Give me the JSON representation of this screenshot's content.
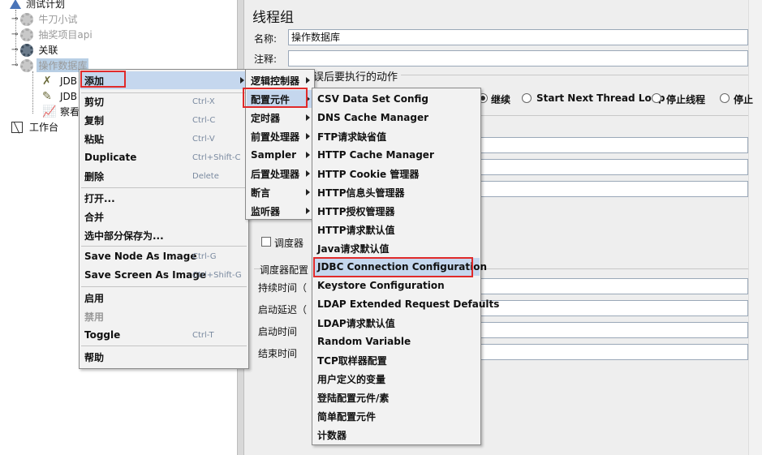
{
  "tree": {
    "test_plan": "测试计划",
    "nodes": [
      "牛刀小试",
      "抽奖项目api",
      "关联",
      "操作数据库"
    ],
    "children": [
      "JDB",
      "JDB",
      "察看"
    ],
    "workbench": "工作台"
  },
  "panel": {
    "title": "线程组",
    "name_label": "名称:",
    "name_value": "操作数据库",
    "comment_label": "注释:",
    "error_action_partial": "误后要执行的动作",
    "options": [
      "继续",
      "Start Next Thread Loop",
      "停止线程",
      "停止"
    ],
    "scheduler_checkbox": "调度器",
    "scheduler_config": "调度器配置",
    "duration_label": "持续时间（",
    "startup_delay_label": "启动延迟（",
    "start_time_label": "启动时间",
    "end_time_label": "结束时间"
  },
  "context_menu": {
    "items": [
      {
        "label": "添加",
        "accel": ""
      },
      {
        "label": "剪切",
        "accel": "Ctrl-X"
      },
      {
        "label": "复制",
        "accel": "Ctrl-C"
      },
      {
        "label": "粘贴",
        "accel": "Ctrl-V"
      },
      {
        "label": "Duplicate",
        "accel": "Ctrl+Shift-C"
      },
      {
        "label": "删除",
        "accel": "Delete"
      },
      {
        "label": "打开...",
        "accel": ""
      },
      {
        "label": "合并",
        "accel": ""
      },
      {
        "label": "选中部分保存为...",
        "accel": ""
      },
      {
        "label": "Save Node As Image",
        "accel": "Ctrl-G"
      },
      {
        "label": "Save Screen As Image",
        "accel": "Ctrl+Shift-G"
      },
      {
        "label": "启用",
        "accel": ""
      },
      {
        "label": "禁用",
        "accel": ""
      },
      {
        "label": "Toggle",
        "accel": "Ctrl-T"
      },
      {
        "label": "帮助",
        "accel": ""
      }
    ]
  },
  "add_submenu": {
    "items": [
      "逻辑控制器",
      "配置元件",
      "定时器",
      "前置处理器",
      "Sampler",
      "后置处理器",
      "断言",
      "监听器"
    ]
  },
  "config_submenu": {
    "items": [
      "CSV Data Set Config",
      "DNS Cache Manager",
      "FTP请求缺省值",
      "HTTP Cache Manager",
      "HTTP Cookie 管理器",
      "HTTP信息头管理器",
      "HTTP授权管理器",
      "HTTP请求默认值",
      "Java请求默认值",
      "JDBC Connection Configuration",
      "Keystore Configuration",
      "LDAP Extended Request Defaults",
      "LDAP请求默认值",
      "Random Variable",
      "TCP取样器配置",
      "用户定义的变量",
      "登陆配置元件/素",
      "简单配置元件",
      "计数器"
    ]
  },
  "colors": {
    "highlight": "#c5d7ee",
    "annotation_red": "#e02a2a",
    "selection": "#b8cfe5"
  }
}
